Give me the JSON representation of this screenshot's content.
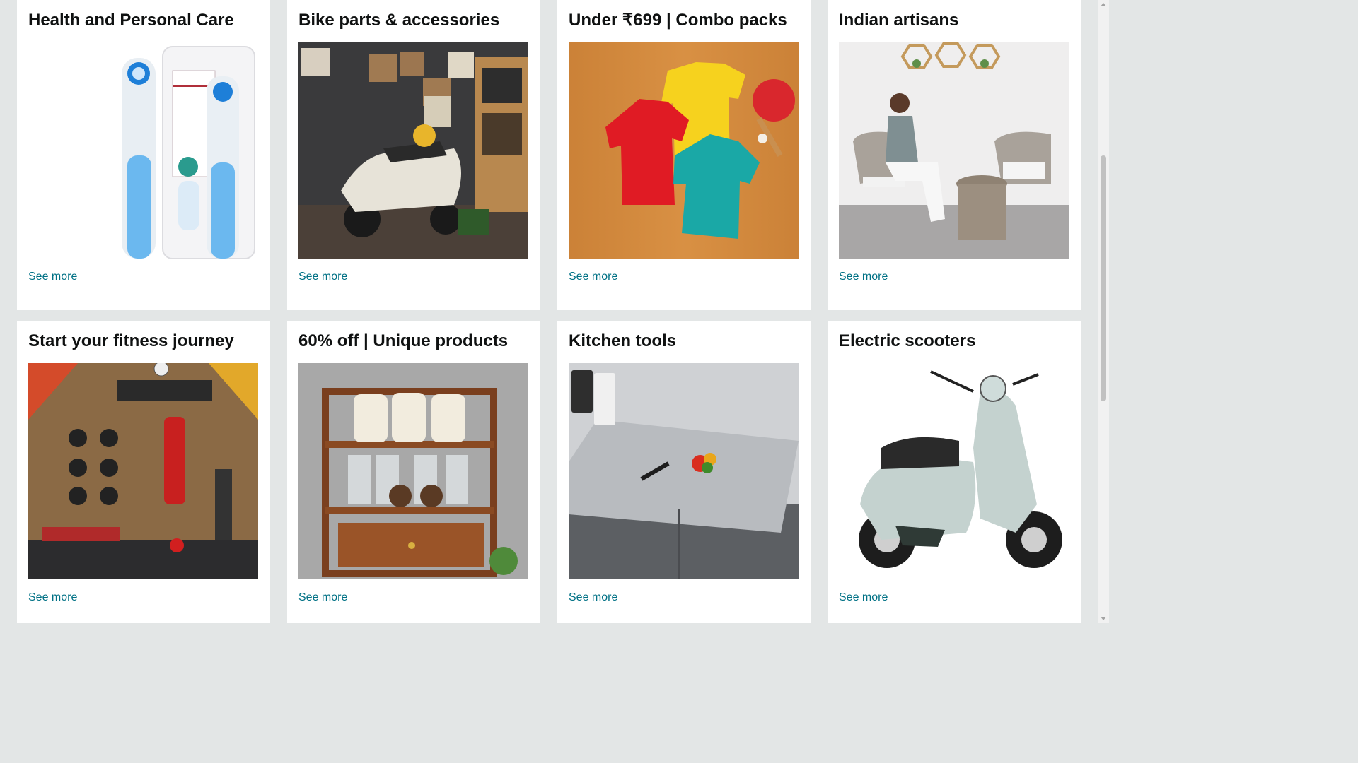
{
  "cards": [
    {
      "title": "Health and Personal Care",
      "link": "See more",
      "image": "electric-toothbrush-product-image"
    },
    {
      "title": "Bike parts & accessories",
      "link": "See more",
      "image": "scooter-garage-image"
    },
    {
      "title": "Under ₹699 | Combo packs",
      "link": "See more",
      "image": "tshirt-combo-image"
    },
    {
      "title": "Indian artisans",
      "link": "See more",
      "image": "patio-furniture-image"
    },
    {
      "title": "Start your fitness journey",
      "link": "See more",
      "image": "home-gym-image"
    },
    {
      "title": "60% off | Unique products",
      "link": "See more",
      "image": "kitchen-rack-image"
    },
    {
      "title": "Kitchen tools",
      "link": "See more",
      "image": "steel-countertop-image"
    },
    {
      "title": "Electric scooters",
      "link": "See more",
      "image": "electric-scooter-image"
    }
  ],
  "colors": {
    "link": "#007185",
    "title": "#0f1111",
    "background": "#e3e6e6"
  }
}
